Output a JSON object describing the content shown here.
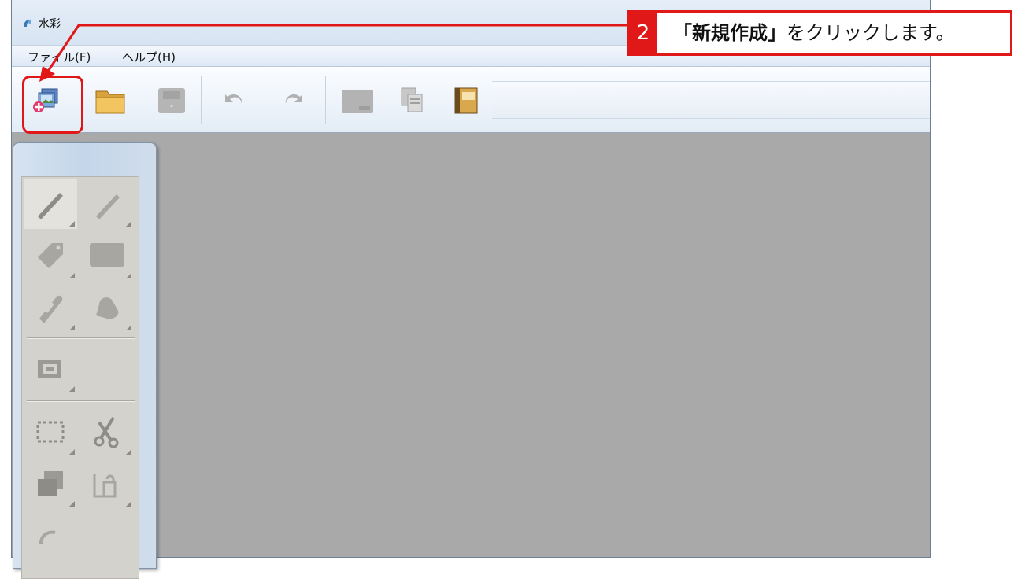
{
  "window": {
    "title": "水彩"
  },
  "menu": [
    {
      "label": "ファイル(F)"
    },
    {
      "label": "ヘルプ(H)"
    }
  ],
  "toolbar": {
    "buttons": [
      {
        "icon": "new-document-icon"
      },
      {
        "icon": "open-folder-icon"
      },
      {
        "icon": "save-icon"
      },
      {
        "icon": "undo-icon"
      },
      {
        "icon": "redo-icon"
      },
      {
        "icon": "image-icon"
      },
      {
        "icon": "copy-icon"
      },
      {
        "icon": "book-icon"
      }
    ]
  },
  "tools": [
    {
      "icon": "brush-icon"
    },
    {
      "icon": "pencil-icon"
    },
    {
      "icon": "tag-eraser-icon"
    },
    {
      "icon": "rectangle-icon"
    },
    {
      "icon": "spray-icon"
    },
    {
      "icon": "fill-bucket-icon"
    },
    {
      "icon": "frame-icon"
    },
    {
      "icon": "marquee-select-icon"
    },
    {
      "icon": "scissors-icon"
    },
    {
      "icon": "layers-icon"
    },
    {
      "icon": "paste-icon"
    }
  ],
  "callout": {
    "number": "2",
    "text_bold": "「新規作成」",
    "text_rest": "をクリックします。"
  },
  "colors": {
    "accent": "#e01818",
    "canvas": "#a9a9a9"
  }
}
